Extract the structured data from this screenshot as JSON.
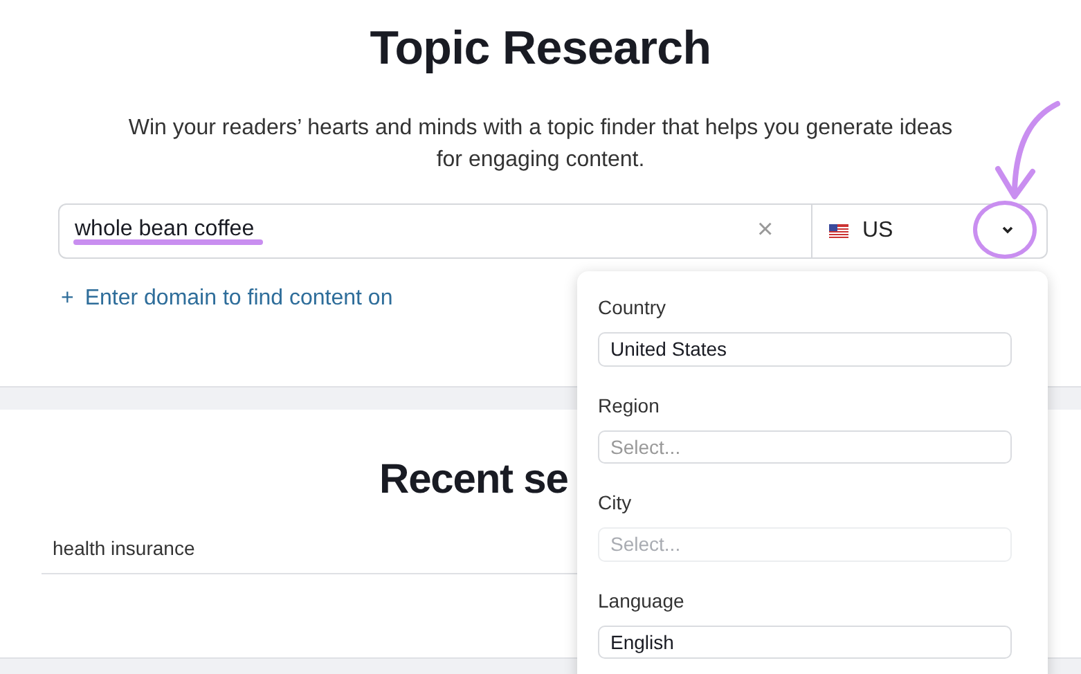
{
  "header": {
    "title": "Topic Research",
    "subtitle": "Win your readers’ hearts and minds with a topic finder that helps you generate ideas for engaging content."
  },
  "search": {
    "value": "whole bean coffee",
    "clear": "×",
    "location": "US",
    "expanded": true
  },
  "domain_link": {
    "icon": "+",
    "label": "Enter domain to find content on"
  },
  "recent": {
    "title": "Recent se",
    "rows": [
      "health insurance"
    ]
  },
  "location_menu": {
    "fields": [
      {
        "label": "Country",
        "value": "United States",
        "disabled": false
      },
      {
        "label": "Region",
        "placeholder": "Select...",
        "disabled": false
      },
      {
        "label": "City",
        "placeholder": "Select...",
        "disabled": true
      },
      {
        "label": "Language",
        "value": "English",
        "disabled": false
      }
    ]
  }
}
